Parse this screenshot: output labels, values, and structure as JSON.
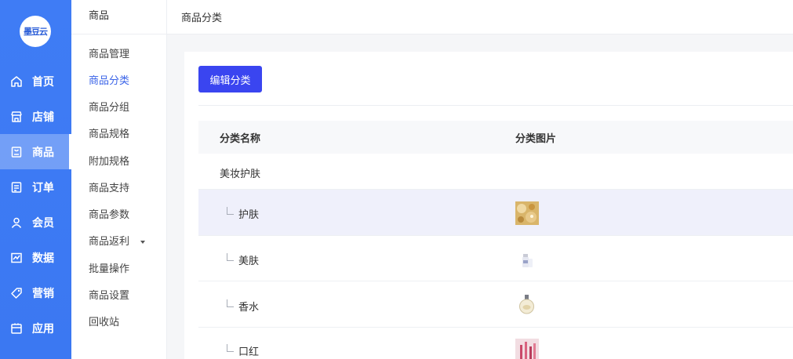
{
  "app": {
    "logo_text": "墨豆云"
  },
  "nav": {
    "items": [
      {
        "label": "首页",
        "icon": "home-icon"
      },
      {
        "label": "店铺",
        "icon": "store-icon"
      },
      {
        "label": "商品",
        "icon": "goods-icon",
        "active": true
      },
      {
        "label": "订单",
        "icon": "order-icon"
      },
      {
        "label": "会员",
        "icon": "member-icon"
      },
      {
        "label": "数据",
        "icon": "data-icon"
      },
      {
        "label": "营销",
        "icon": "tag-icon"
      },
      {
        "label": "应用",
        "icon": "app-icon"
      }
    ]
  },
  "subnav": {
    "title": "商品",
    "items": [
      {
        "label": "商品管理"
      },
      {
        "label": "商品分类",
        "active": true
      },
      {
        "label": "商品分组"
      },
      {
        "label": "商品规格"
      },
      {
        "label": "附加规格"
      },
      {
        "label": "商品支持"
      },
      {
        "label": "商品参数"
      },
      {
        "label": "商品返利",
        "has_submenu": true
      },
      {
        "label": "批量操作"
      },
      {
        "label": "商品设置"
      },
      {
        "label": "回收站"
      }
    ]
  },
  "header": {
    "breadcrumb": "商品分类"
  },
  "main": {
    "edit_button": "编辑分类",
    "table": {
      "columns": [
        "分类名称",
        "分类图片"
      ],
      "rows": [
        {
          "name": "美妆护肤",
          "level": 0,
          "has_image": false
        },
        {
          "name": "护肤",
          "level": 1,
          "has_image": true,
          "image": "skincare-photo",
          "highlighted": true
        },
        {
          "name": "美肤",
          "level": 1,
          "has_image": true,
          "image": "beauty-bottle-photo"
        },
        {
          "name": "香水",
          "level": 1,
          "has_image": true,
          "image": "perfume-photo"
        },
        {
          "name": "口红",
          "level": 1,
          "has_image": true,
          "image": "lipstick-photo"
        }
      ]
    }
  },
  "colors": {
    "nav_bg": "#3f7cf5",
    "primary_button": "#3a45f0",
    "active_text": "#3b64e8",
    "row_highlight": "#eff0fb"
  }
}
